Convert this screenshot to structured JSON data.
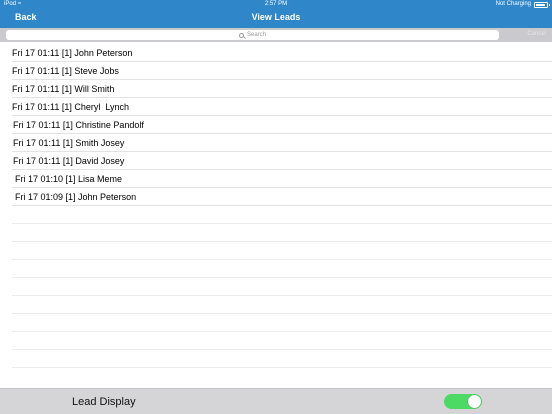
{
  "status_bar": {
    "device": "iPod",
    "time": "2:57 PM",
    "battery_text": "Not Charging",
    "battery_level": 0.9
  },
  "nav": {
    "back_label": "Back",
    "title": "View Leads"
  },
  "search": {
    "placeholder": "Search",
    "cancel_label": "Cancel"
  },
  "leads": [
    {
      "text": "Fri 17 01:11 [1] John Peterson"
    },
    {
      "text": "Fri 17 01:11 [1] Steve Jobs"
    },
    {
      "text": "Fri 17 01:11 [1] Will Smith"
    },
    {
      "text": "Fri 17 01:11 [1] Cheryl  Lynch"
    },
    {
      "text": "Fri 17 01:11 [1] Christine Pandolf"
    },
    {
      "text": "Fri 17 01:11 [1] Smith Josey"
    },
    {
      "text": "Fri 17 01:11 [1] David Josey"
    },
    {
      "text": "Fri 17 01:10 [1] Lisa Meme"
    },
    {
      "text": "Fri 17 01:09 [1] John Peterson"
    }
  ],
  "footer": {
    "label": "Lead Display",
    "toggle_on": true
  },
  "colors": {
    "nav_bar": "#2f86c9",
    "toggle_on": "#4cd964",
    "footer_bg": "#d5d5d7"
  }
}
